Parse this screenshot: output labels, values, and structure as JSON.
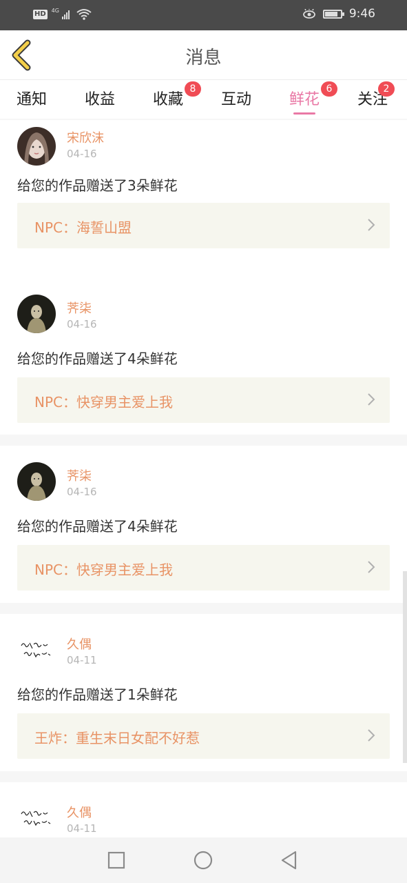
{
  "status_bar": {
    "hd": "HD",
    "network": "4G",
    "time": "9:46",
    "battery_level": 0.8
  },
  "header": {
    "title": "消息"
  },
  "tabs": [
    {
      "label": "通知",
      "badge": null,
      "active": false
    },
    {
      "label": "收益",
      "badge": null,
      "active": false
    },
    {
      "label": "收藏",
      "badge": "8",
      "active": false
    },
    {
      "label": "互动",
      "badge": null,
      "active": false
    },
    {
      "label": "鲜花",
      "badge": "6",
      "active": true
    },
    {
      "label": "关注",
      "badge": "2",
      "active": false
    }
  ],
  "messages": [
    {
      "user": "宋欣沫",
      "date": "04-16",
      "text": "给您的作品赠送了3朵鲜花",
      "work": "NPC：海誓山盟",
      "avatar": "portrait-photo"
    },
    {
      "user": "荠柒",
      "date": "04-16",
      "text": "给您的作品赠送了4朵鲜花",
      "work": "NPC：快穿男主爱上我",
      "avatar": "dark-figure"
    },
    {
      "user": "荠柒",
      "date": "04-16",
      "text": "给您的作品赠送了4朵鲜花",
      "work": "NPC：快穿男主爱上我",
      "avatar": "dark-figure"
    },
    {
      "user": "久偶",
      "date": "04-11",
      "text": "给您的作品赠送了1朵鲜花",
      "work": "王炸：重生末日女配不好惹",
      "avatar": "handwriting"
    },
    {
      "user": "久偶",
      "date": "04-11",
      "avatar": "handwriting"
    }
  ],
  "colors": {
    "accent": "#e978a5",
    "username": "#e89365",
    "badge": "#f04c55",
    "back_arrow": "#f3cf4a"
  },
  "nav_bar": {
    "icons": [
      "square-recent-icon",
      "circle-home-icon",
      "triangle-back-icon"
    ]
  }
}
